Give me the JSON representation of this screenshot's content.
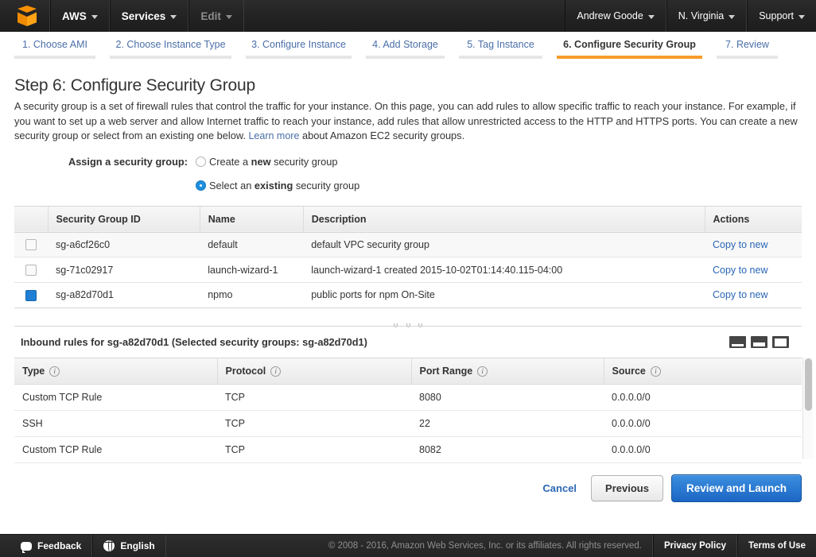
{
  "topnav": {
    "logo_icon": "aws-cube-logo",
    "left_items": [
      {
        "label": "AWS",
        "caret": true,
        "dim": false
      },
      {
        "label": "Services",
        "caret": true,
        "dim": false
      },
      {
        "label": "Edit",
        "caret": true,
        "dim": true
      }
    ],
    "right_items": [
      {
        "label": "Andrew Goode",
        "caret": true
      },
      {
        "label": "N. Virginia",
        "caret": true
      },
      {
        "label": "Support",
        "caret": true
      }
    ]
  },
  "wizard_tabs": [
    {
      "label": "1. Choose AMI",
      "active": false
    },
    {
      "label": "2. Choose Instance Type",
      "active": false
    },
    {
      "label": "3. Configure Instance",
      "active": false
    },
    {
      "label": "4. Add Storage",
      "active": false
    },
    {
      "label": "5. Tag Instance",
      "active": false
    },
    {
      "label": "6. Configure Security Group",
      "active": true
    },
    {
      "label": "7. Review",
      "active": false
    }
  ],
  "page": {
    "title": "Step 6: Configure Security Group",
    "description_part1": "A security group is a set of firewall rules that control the traffic for your instance. On this page, you can add rules to allow specific traffic to reach your instance. For example, if you want to set up a web server and allow Internet traffic to reach your instance, add rules that allow unrestricted access to the HTTP and HTTPS ports. You can create a new security group or select from an existing one below. ",
    "learn_more": "Learn more",
    "description_part2": " about Amazon EC2 security groups."
  },
  "assign": {
    "label": "Assign a security group:",
    "options": [
      {
        "pre": "Create a ",
        "bold": "new",
        "post": " security group",
        "selected": false
      },
      {
        "pre": "Select an ",
        "bold": "existing",
        "post": " security group",
        "selected": true
      }
    ]
  },
  "sg_table": {
    "headers": [
      "",
      "Security Group ID",
      "Name",
      "Description",
      "Actions"
    ],
    "action_label": "Copy to new",
    "rows": [
      {
        "selected": false,
        "id": "sg-a6cf26c0",
        "name": "default",
        "description": "default VPC security group",
        "action": "Copy to new"
      },
      {
        "selected": false,
        "id": "sg-71c02917",
        "name": "launch-wizard-1",
        "description": "launch-wizard-1 created 2015-10-02T01:14:40.115-04:00",
        "action": "Copy to new"
      },
      {
        "selected": true,
        "id": "sg-a82d70d1",
        "name": "npmo",
        "description": "public ports for npm On-Site",
        "action": "Copy to new"
      }
    ]
  },
  "inbound_panel": {
    "title": "Inbound rules for sg-a82d70d1 (Selected security groups: sg-a82d70d1)",
    "grip_icon": "drag-handle-icon",
    "view_icons": [
      "split-view-small-icon",
      "split-view-medium-icon",
      "split-view-large-icon"
    ],
    "headers": [
      "Type",
      "Protocol",
      "Port Range",
      "Source"
    ],
    "info_icon": "info-icon",
    "rules": [
      {
        "type": "Custom TCP Rule",
        "protocol": "TCP",
        "port_range": "8080",
        "source": "0.0.0.0/0"
      },
      {
        "type": "SSH",
        "protocol": "TCP",
        "port_range": "22",
        "source": "0.0.0.0/0"
      },
      {
        "type": "Custom TCP Rule",
        "protocol": "TCP",
        "port_range": "8082",
        "source": "0.0.0.0/0"
      }
    ]
  },
  "actions": {
    "cancel": "Cancel",
    "previous": "Previous",
    "review_and_launch": "Review and Launch"
  },
  "footer": {
    "feedback": "Feedback",
    "feedback_icon": "speech-bubble-icon",
    "language": "English",
    "language_icon": "globe-icon",
    "copyright": "© 2008 - 2016, Amazon Web Services, Inc. or its affiliates. All rights reserved.",
    "privacy_policy": "Privacy Policy",
    "terms_of_use": "Terms of Use"
  },
  "colors": {
    "accent_orange": "#f89c2a",
    "link_blue": "#2a66b5",
    "primary_button": "#1c66c4",
    "selected_checkbox": "#1e7fd4"
  }
}
